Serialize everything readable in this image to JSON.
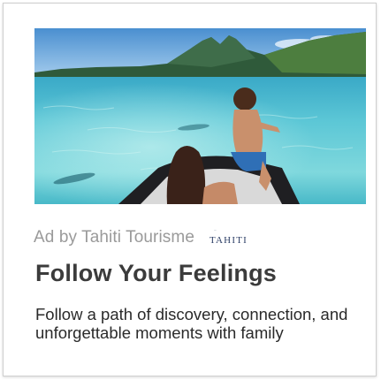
{
  "ad": {
    "image_alt": "Two children on a boat looking out over a turquoise lagoon toward a mountain island",
    "sponsor_text": "Ad by Tahiti Tourisme",
    "brand_logo_text": "TAHITI",
    "title": "Follow Your Feelings",
    "description": "Follow a path of discovery, connection, and unforgettable moments with family"
  },
  "colors": {
    "sponsor": "#9a9a9a",
    "title": "#3b3b3b",
    "body": "#2a2a2a",
    "logo": "#2c3e66"
  }
}
